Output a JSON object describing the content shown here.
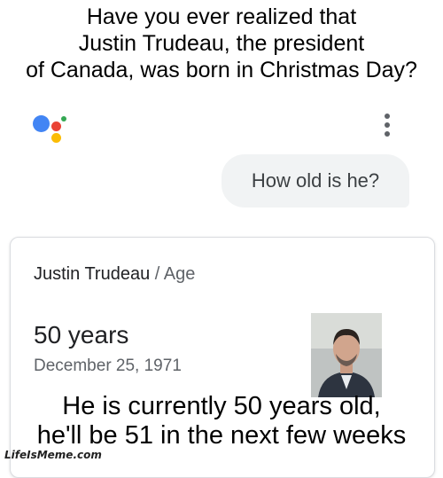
{
  "top_caption": {
    "line1": "Have you ever realized that",
    "line2": "Justin Trudeau, the president",
    "line3": "of Canada, was born in Christmas Day?"
  },
  "assistant": {
    "logo_icon": "google-assistant-icon",
    "menu_icon": "more-vert-icon",
    "query": "How old is he?"
  },
  "result_card": {
    "entity": "Justin Trudeau",
    "separator": "/",
    "attribute": "Age",
    "age": "50 years",
    "birth_date": "December 25, 1971"
  },
  "bottom_caption": {
    "line1": "He is currently 50 years old,",
    "line2": "he'll be 51 in the next few weeks"
  },
  "watermark": "LifeIsMeme.com",
  "colors": {
    "assistant_blue": "#4285f4",
    "assistant_red": "#ea4335",
    "assistant_yellow": "#fbbc05",
    "assistant_green": "#34a853",
    "bubble_bg": "#f1f3f4"
  }
}
